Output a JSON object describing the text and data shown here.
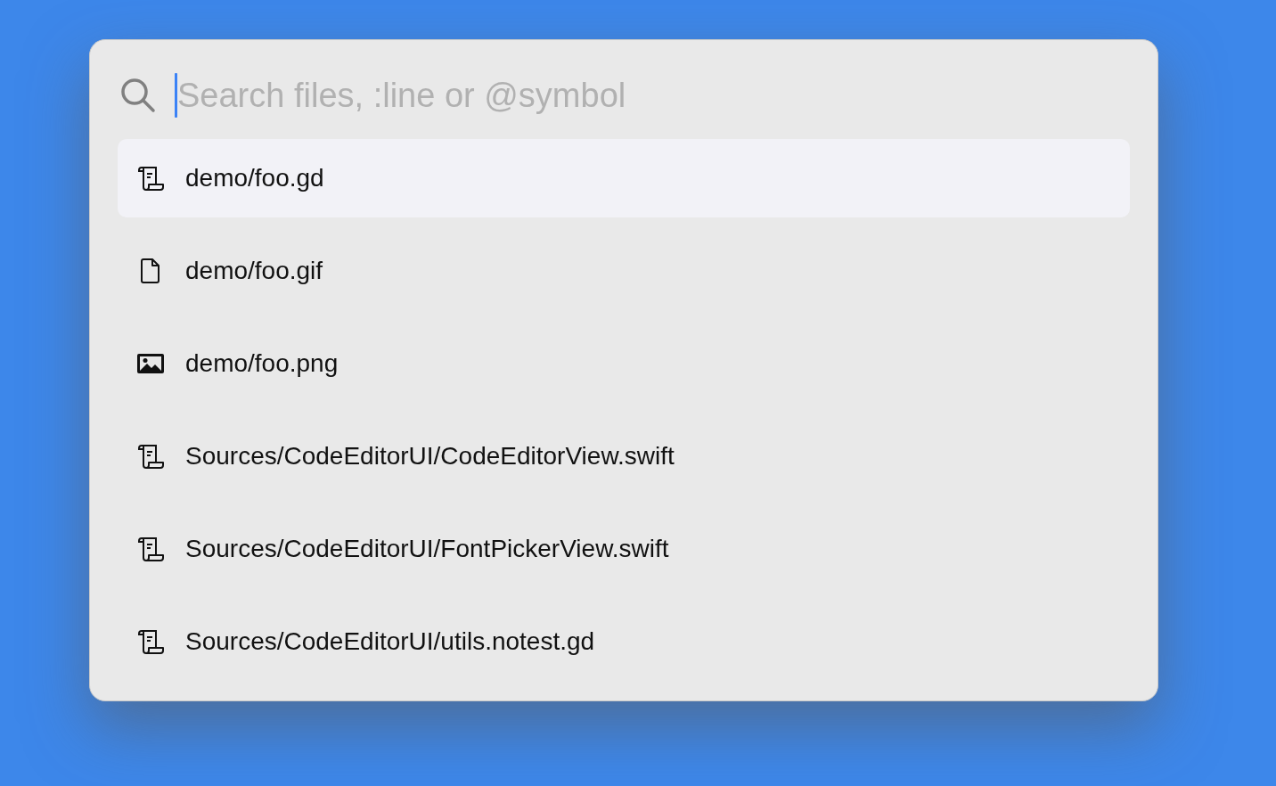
{
  "search": {
    "placeholder": "Search files, :line or @symbol"
  },
  "results": [
    {
      "kind": "script",
      "path": "demo/foo.gd",
      "selected": true
    },
    {
      "kind": "document",
      "path": "demo/foo.gif",
      "selected": false
    },
    {
      "kind": "image",
      "path": "demo/foo.png",
      "selected": false
    },
    {
      "kind": "script",
      "path": "Sources/CodeEditorUI/CodeEditorView.swift",
      "selected": false
    },
    {
      "kind": "script",
      "path": "Sources/CodeEditorUI/FontPickerView.swift",
      "selected": false
    },
    {
      "kind": "script",
      "path": "Sources/CodeEditorUI/utils.notest.gd",
      "selected": false
    }
  ]
}
